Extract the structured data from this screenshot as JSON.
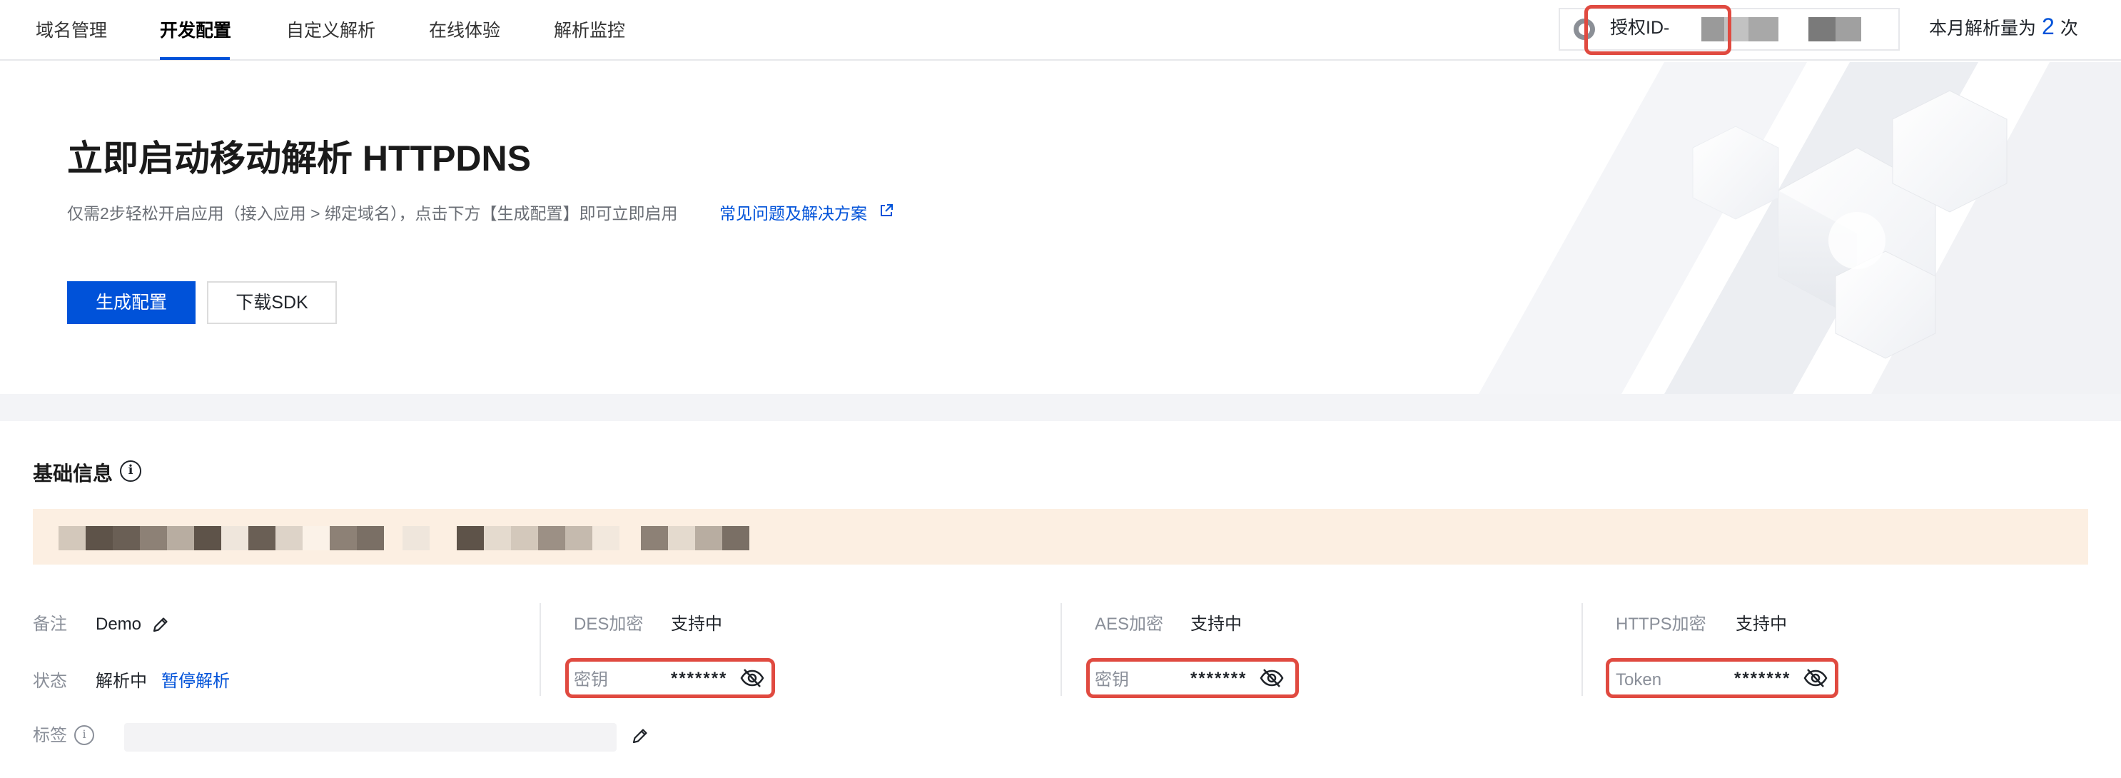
{
  "nav": {
    "tabs": [
      {
        "label": "域名管理"
      },
      {
        "label": "开发配置"
      },
      {
        "label": "自定义解析"
      },
      {
        "label": "在线体验"
      },
      {
        "label": "解析监控"
      }
    ],
    "active_tab": "开发配置",
    "auth_label": "授权ID-",
    "usage_prefix": "本月解析量为",
    "usage_count": "2",
    "usage_suffix": "次"
  },
  "hero": {
    "title": "立即启动移动解析 HTTPDNS",
    "subtitle": "仅需2步轻松开启应用（接入应用 > 绑定域名），点击下方【生成配置】即可立即启用",
    "faq_link": "常见问题及解决方案",
    "primary_button": "生成配置",
    "secondary_button": "下载SDK"
  },
  "basic_info": {
    "title": "基础信息",
    "remark_label": "备注",
    "remark_value": "Demo",
    "status_label": "状态",
    "status_value": "解析中",
    "pause_link": "暂停解析",
    "tag_label": "标签",
    "des_label": "DES加密",
    "des_status": "支持中",
    "des_key_label": "密钥",
    "des_key_value": "*******",
    "aes_label": "AES加密",
    "aes_status": "支持中",
    "aes_key_label": "密钥",
    "aes_key_value": "*******",
    "https_label": "HTTPS加密",
    "https_status": "支持中",
    "https_token_label": "Token",
    "https_token_value": "*******"
  },
  "colors": {
    "brand": "#0052d9",
    "highlight_border": "#e04a40",
    "banner_bg": "#fcefe2"
  }
}
